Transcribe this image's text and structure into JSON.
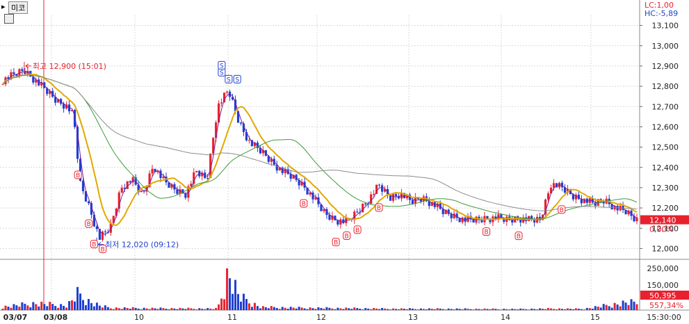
{
  "toolbar": {
    "symbol_label": "미코",
    "grid_icon": "grid-icon"
  },
  "header_info": {
    "lc": "LC:1,00",
    "hc": "HC:-5,89"
  },
  "colors": {
    "up": "#e8212e",
    "down": "#1e3fd0",
    "ma_fast": "#7a1fa2",
    "ma_mid": "#e0a800",
    "ma_slow": "#3a9a3a",
    "ma_long": "#8c8c8c",
    "grid": "#d8d8d8",
    "label_box": "#e8212e",
    "signal_b": "#e8212e",
    "signal_s": "#1e3fd0"
  },
  "chart_data": {
    "type": "candlestick",
    "price_axis": {
      "range": [
        11950,
        13150
      ],
      "ticks": [
        "12,000",
        "12,100",
        "12,200",
        "12,300",
        "12,400",
        "12,500",
        "12,600",
        "12,700",
        "12,800",
        "12,900",
        "13,000",
        "13,100"
      ]
    },
    "time_labels": [
      "03/07",
      "03/08",
      "10",
      "11",
      "12",
      "13",
      "14",
      "15",
      "15:30:00"
    ],
    "annotations": {
      "high": {
        "text": "최고 12,900 (15:01)",
        "price": 12900
      },
      "low": {
        "text": "최저 12,020 (09:12)",
        "price": 12020
      }
    },
    "current_price": {
      "text": "12,140",
      "value": 12140,
      "change": "0,00%"
    },
    "volume": {
      "ticks": [
        "250,000",
        "150,000",
        "50,000"
      ],
      "ylim": [
        0,
        300000
      ],
      "current_value": "50,395",
      "current_pct": "557,34%"
    },
    "signals": {
      "buy_label": "B",
      "sell_label": "S",
      "buy_count": 12,
      "sell_count": 4
    },
    "close_path": [
      [
        0,
        12830
      ],
      [
        2,
        12880
      ],
      [
        4,
        12780
      ],
      [
        5,
        12730
      ],
      [
        6,
        12700
      ],
      [
        6.6,
        12650
      ],
      [
        7.2,
        12320
      ],
      [
        8,
        12210
      ],
      [
        9,
        12050
      ],
      [
        10,
        12100
      ],
      [
        11,
        12300
      ],
      [
        12,
        12340
      ],
      [
        13,
        12260
      ],
      [
        14,
        12410
      ],
      [
        15,
        12330
      ],
      [
        16,
        12290
      ],
      [
        17,
        12270
      ],
      [
        18,
        12380
      ],
      [
        19,
        12340
      ],
      [
        20,
        12700
      ],
      [
        21,
        12780
      ],
      [
        22,
        12620
      ],
      [
        23,
        12520
      ],
      [
        24,
        12480
      ],
      [
        25,
        12430
      ],
      [
        26,
        12380
      ],
      [
        27,
        12350
      ],
      [
        28,
        12310
      ],
      [
        29,
        12240
      ],
      [
        30,
        12170
      ],
      [
        31,
        12140
      ],
      [
        32,
        12130
      ],
      [
        33,
        12180
      ],
      [
        34,
        12240
      ],
      [
        35,
        12310
      ],
      [
        36,
        12250
      ],
      [
        37,
        12270
      ],
      [
        38,
        12230
      ],
      [
        39,
        12250
      ],
      [
        40,
        12220
      ],
      [
        41,
        12180
      ],
      [
        42,
        12160
      ],
      [
        43,
        12140
      ],
      [
        44,
        12140
      ],
      [
        45,
        12150
      ],
      [
        46,
        12150
      ],
      [
        47,
        12140
      ],
      [
        48,
        12150
      ],
      [
        49,
        12140
      ],
      [
        50,
        12140
      ],
      [
        51,
        12320
      ],
      [
        52,
        12300
      ],
      [
        53,
        12260
      ],
      [
        54,
        12240
      ],
      [
        55,
        12220
      ],
      [
        56,
        12240
      ],
      [
        57,
        12200
      ],
      [
        58,
        12180
      ],
      [
        59,
        12140
      ]
    ],
    "volume_profile": [
      [
        0,
        22000
      ],
      [
        3,
        45000
      ],
      [
        6,
        30000
      ],
      [
        7,
        110000
      ],
      [
        8,
        60000
      ],
      [
        9,
        30000
      ],
      [
        10,
        15000
      ],
      [
        14,
        12000
      ],
      [
        20,
        10000
      ],
      [
        21,
        260000
      ],
      [
        22,
        90000
      ],
      [
        24,
        20000
      ],
      [
        28,
        15000
      ],
      [
        33,
        12000
      ],
      [
        36,
        9000
      ],
      [
        40,
        9000
      ],
      [
        44,
        8000
      ],
      [
        48,
        7000
      ],
      [
        51,
        10000
      ],
      [
        54,
        8000
      ],
      [
        58,
        50395
      ]
    ]
  }
}
